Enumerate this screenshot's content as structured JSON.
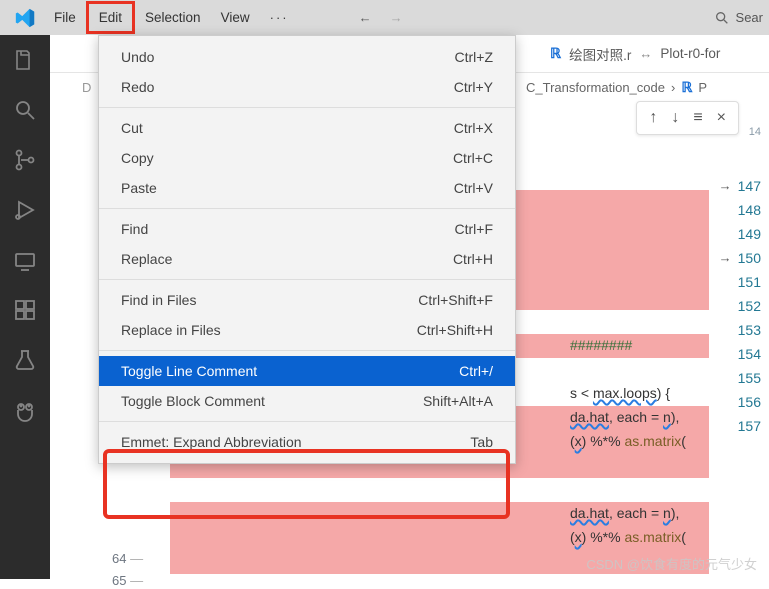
{
  "menubar": {
    "items": [
      "File",
      "Edit",
      "Selection",
      "View"
    ],
    "overflow": "···",
    "search_label": "Sear"
  },
  "tabs": {
    "file1": "绘图对照.r",
    "file2": "Plot-r0-for"
  },
  "breadcrumb": {
    "segment": "C_Transformation_code",
    "file_prefix": "P"
  },
  "editor_toolbar": {
    "up": "↑",
    "down": "↓",
    "list": "≡",
    "close": "×"
  },
  "dropdown": {
    "items": [
      {
        "label": "Undo",
        "shortcut": "Ctrl+Z"
      },
      {
        "label": "Redo",
        "shortcut": "Ctrl+Y"
      },
      {
        "sep": true
      },
      {
        "label": "Cut",
        "shortcut": "Ctrl+X"
      },
      {
        "label": "Copy",
        "shortcut": "Ctrl+C"
      },
      {
        "label": "Paste",
        "shortcut": "Ctrl+V"
      },
      {
        "sep": true
      },
      {
        "label": "Find",
        "shortcut": "Ctrl+F"
      },
      {
        "label": "Replace",
        "shortcut": "Ctrl+H"
      },
      {
        "sep": true
      },
      {
        "label": "Find in Files",
        "shortcut": "Ctrl+Shift+F"
      },
      {
        "label": "Replace in Files",
        "shortcut": "Ctrl+Shift+H"
      },
      {
        "sep": true
      },
      {
        "label": "Toggle Line Comment",
        "shortcut": "Ctrl+/",
        "selected": true
      },
      {
        "label": "Toggle Block Comment",
        "shortcut": "Shift+Alt+A"
      },
      {
        "sep": true
      },
      {
        "label": "Emmet: Expand Abbreviation",
        "shortcut": "Tab"
      }
    ]
  },
  "gutter_numbers": [
    "14",
    "147",
    "148",
    "149",
    "150",
    "151",
    "152",
    "153",
    "154",
    "155",
    "156",
    "157"
  ],
  "gutter_arrows": [
    1,
    4
  ],
  "left_gutter": {
    "a": "64",
    "b": "65"
  },
  "code": {
    "l1": "",
    "l2": "",
    "l3": "",
    "l4": "########",
    "l5": "",
    "l6": "s < max.loops) {",
    "l7": "da.hat, each = n),",
    "l8": "(x) %*% as.matrix(",
    "l9": "",
    "l10": "da.hat, each = n),",
    "l11": "(x) %*% as.matrix("
  },
  "watermark": "CSDN @饮食有度的元气少女"
}
